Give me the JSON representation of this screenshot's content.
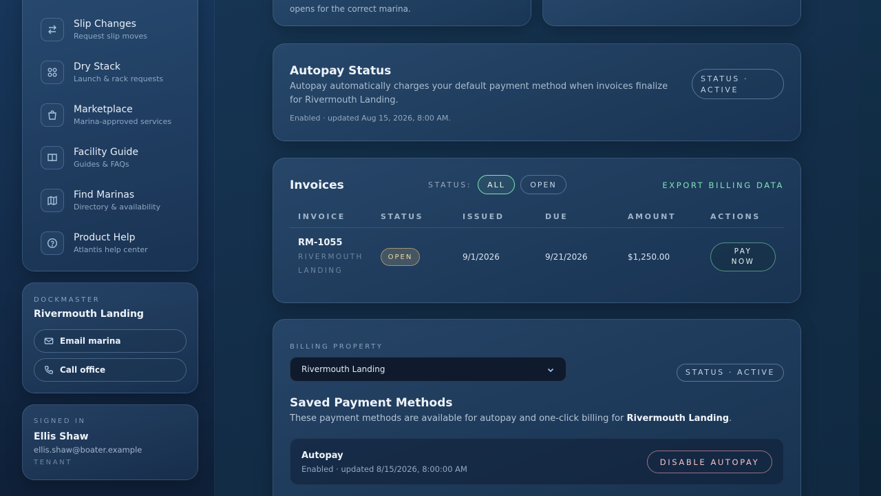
{
  "sidebar": {
    "nav": [
      {
        "title": "Slip Changes",
        "sub": "Request slip moves",
        "icon": "swap-arrows-icon"
      },
      {
        "title": "Dry Stack",
        "sub": "Launch & rack requests",
        "icon": "grid-icon"
      },
      {
        "title": "Marketplace",
        "sub": "Marina-approved services",
        "icon": "shopping-bag-icon"
      },
      {
        "title": "Facility Guide",
        "sub": "Guides & FAQs",
        "icon": "book-icon"
      },
      {
        "title": "Find Marinas",
        "sub": "Directory & availability",
        "icon": "map-icon"
      },
      {
        "title": "Product Help",
        "sub": "Atlantis help center",
        "icon": "question-circle-icon"
      }
    ],
    "dockmaster": {
      "eyebrow": "DOCKMASTER",
      "name": "Rivermouth Landing",
      "email_label": "Email marina",
      "call_label": "Call office"
    },
    "signed_in": {
      "eyebrow": "SIGNED IN",
      "name": "Ellis Shaw",
      "email": "ellis.shaw@boater.example",
      "role": "TENANT"
    }
  },
  "top_card": {
    "text": "opens for the correct marina."
  },
  "autopay": {
    "title": "Autopay Status",
    "description": "Autopay automatically charges your default payment method when invoices finalize for Rivermouth Landing.",
    "meta": "Enabled · updated Aug 15, 2026, 8:00 AM.",
    "status_line1": "STATUS ·",
    "status_line2": "ACTIVE"
  },
  "invoices": {
    "title": "Invoices",
    "filter_label": "STATUS:",
    "filter_all": "ALL",
    "filter_open": "OPEN",
    "export_label": "EXPORT BILLING DATA",
    "columns": [
      "INVOICE",
      "STATUS",
      "ISSUED",
      "DUE",
      "AMOUNT",
      "ACTIONS"
    ],
    "rows": [
      {
        "id": "RM-1055",
        "property_line1": "RIVERMOUTH",
        "property_line2": "LANDING",
        "status": "OPEN",
        "issued": "9/1/2026",
        "due": "9/21/2026",
        "amount": "$1,250.00",
        "action_line1": "PAY",
        "action_line2": "NOW"
      }
    ]
  },
  "billing": {
    "property_label": "BILLING PROPERTY",
    "property_value": "Rivermouth Landing",
    "status_badge": "STATUS · ACTIVE",
    "methods_title": "Saved Payment Methods",
    "methods_desc_prefix": "These payment methods are available for autopay and one-click billing for ",
    "methods_desc_bold": "Rivermouth Landing",
    "methods_desc_suffix": ".",
    "autopay_title": "Autopay",
    "autopay_meta": "Enabled · updated 8/15/2026, 8:00:00 AM",
    "disable_label": "DISABLE AUTOPAY"
  },
  "colors": {
    "accent_green": "#7fe3b5",
    "open_badge": "#e8c77a",
    "danger": "#f0a3ab"
  }
}
